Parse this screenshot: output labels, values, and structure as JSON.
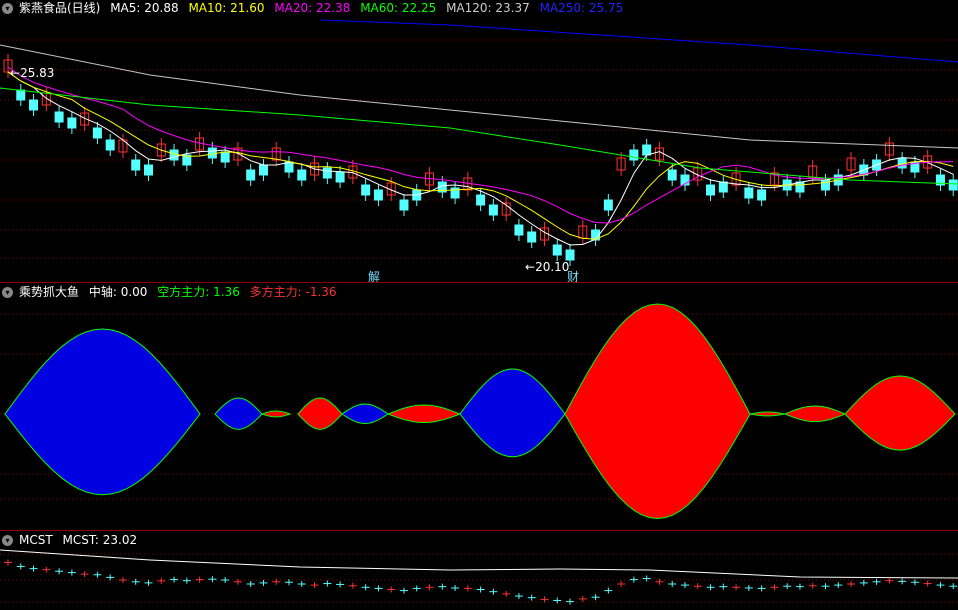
{
  "main": {
    "title": "紫燕食品(日线)",
    "ma": [
      {
        "label": "MA5: 20.88",
        "color": "#ffffff"
      },
      {
        "label": "MA10: 21.60",
        "color": "#ffff00"
      },
      {
        "label": "MA20: 22.38",
        "color": "#ff00ff"
      },
      {
        "label": "MA60: 22.25",
        "color": "#00ff00"
      },
      {
        "label": "MA120: 23.37",
        "color": "#c8c8c8"
      },
      {
        "label": "MA250: 25.75",
        "color": "#0000ff"
      }
    ],
    "high_label": "25.83",
    "low_label": "20.10",
    "marker_jie": "解",
    "marker_cai": "财"
  },
  "indicator": {
    "name": "乘势抓大鱼",
    "zhongzhou": "中轴: 0.00",
    "kongfang": "空方主力: 1.36",
    "duofang": "多方主力: -1.36",
    "colors": {
      "blue": "#0000e0",
      "red": "#ff0000",
      "green": "#00ff00"
    }
  },
  "mcst": {
    "name": "MCST",
    "value": "MCST: 23.02"
  },
  "colors": {
    "up": "#ff3232",
    "down": "#54ffff",
    "grid": "#8b0000",
    "separator": "#8b0000"
  }
}
